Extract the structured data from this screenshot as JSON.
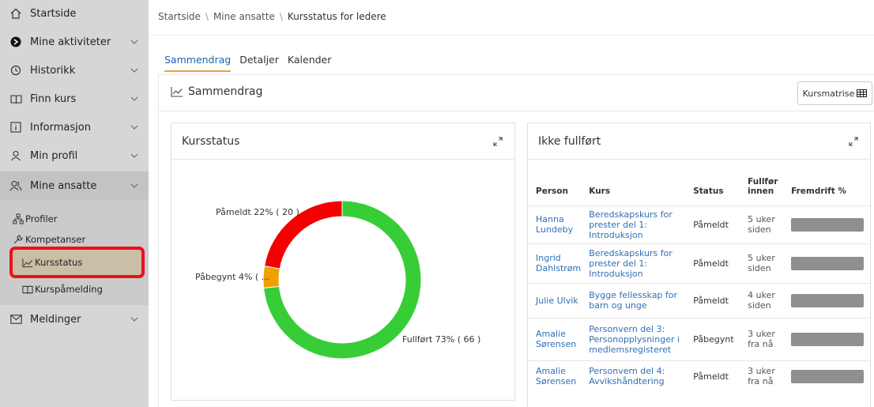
{
  "sidebar": {
    "items": [
      {
        "label": "Startside",
        "icon": "home-icon"
      },
      {
        "label": "Mine aktiviteter",
        "icon": "arrow-circle-icon"
      },
      {
        "label": "Historikk",
        "icon": "history-icon"
      },
      {
        "label": "Finn kurs",
        "icon": "book-icon"
      },
      {
        "label": "Informasjon",
        "icon": "info-icon"
      },
      {
        "label": "Min profil",
        "icon": "user-icon"
      },
      {
        "label": "Mine ansatte",
        "icon": "users-icon"
      },
      {
        "label": "Meldinger",
        "icon": "envelope-icon"
      }
    ],
    "subitems": [
      {
        "label": "Profiler",
        "icon": "sitemap-icon"
      },
      {
        "label": "Kompetanser",
        "icon": "tools-icon"
      },
      {
        "label": "Kursstatus",
        "icon": "chart-line-icon"
      },
      {
        "label": "Kurspåmelding",
        "icon": "book-icon"
      }
    ]
  },
  "breadcrumb": {
    "items": [
      "Startside",
      "Mine ansatte",
      "Kursstatus for ledere"
    ],
    "separator": "\\"
  },
  "tabs": [
    {
      "label": "Sammendrag",
      "active": true
    },
    {
      "label": "Detaljer",
      "active": false
    },
    {
      "label": "Kalender",
      "active": false
    }
  ],
  "summary": {
    "title": "Sammendrag",
    "matrix_button": "Kursmatrise"
  },
  "status_card": {
    "title": "Kursstatus",
    "labels": {
      "registered": "Påmeldt 22% ( 20 )",
      "started": "Påbegynt 4% ( ...",
      "completed": "Fullført 73% ( 66 )"
    }
  },
  "chart_data": {
    "type": "pie",
    "categories": [
      "Påmeldt",
      "Påbegynt",
      "Fullført"
    ],
    "values": [
      20,
      4,
      66
    ],
    "percent": [
      22,
      4,
      73
    ],
    "colors": [
      "#f40000",
      "#f0a000",
      "#37cd37"
    ],
    "title": "Kursstatus",
    "donut": true
  },
  "incomplete_card": {
    "title": "Ikke fullført",
    "columns": [
      "Person",
      "Kurs",
      "Status",
      "Fullfør innen",
      "Fremdrift %"
    ],
    "rows": [
      {
        "person": "Hanna Lundeby",
        "course": "Beredskapskurs for prester del 1: Introduksjon",
        "status": "Påmeldt",
        "due": "5 uker siden"
      },
      {
        "person": "Ingrid Dahlstrøm",
        "course": "Beredskapskurs for prester del 1: Introduksjon",
        "status": "Påmeldt",
        "due": "5 uker siden"
      },
      {
        "person": "Julie Ulvik",
        "course": "Bygge fellesskap for barn og unge",
        "status": "Påmeldt",
        "due": "4 uker siden"
      },
      {
        "person": "Amalie Sørensen",
        "course": "Personvern del 3: Personopplysninger i medlemsregisteret",
        "status": "Påbegynt",
        "due": "3 uker fra nå"
      },
      {
        "person": "Amalie Sørensen",
        "course": "Personvern del 4: Avvikshåndtering",
        "status": "Påmeldt",
        "due": "3 uker fra nå"
      }
    ]
  }
}
